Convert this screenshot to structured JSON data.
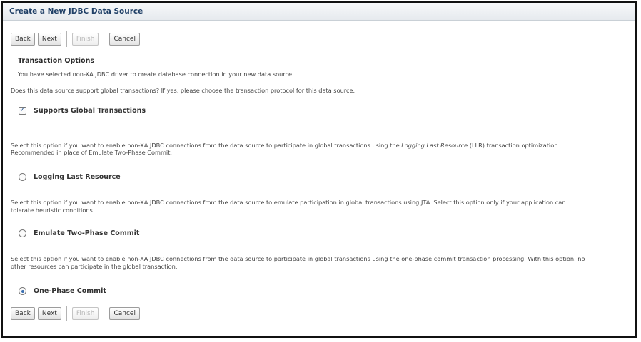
{
  "window": {
    "title": "Create a New JDBC Data Source"
  },
  "buttons": {
    "back": "Back",
    "next": "Next",
    "finish": "Finish",
    "cancel": "Cancel"
  },
  "section": {
    "title": "Transaction Options",
    "info": "You have selected non-XA JDBC driver to create database connection in your new data source.",
    "question": "Does this data source support global transactions? If yes, please choose the transaction protocol for this data source."
  },
  "global": {
    "label": "Supports Global Transactions",
    "checked": true
  },
  "options": [
    {
      "desc_line1_a": "Select this option if you want to enable non-XA JDBC connections from the data source to participate in global transactions using the ",
      "desc_line1_italic": "Logging Last Resource",
      "desc_line1_b": " (LLR) transaction optimization.",
      "desc_line2": "Recommended in place of Emulate Two-Phase Commit.",
      "label": "Logging Last Resource",
      "selected": false
    },
    {
      "desc_line1": "Select this option if you want to enable non-XA JDBC connections from the data source to emulate participation in global transactions using JTA. Select this option only if your application can",
      "desc_line2": "tolerate heuristic conditions.",
      "label": "Emulate Two-Phase Commit",
      "selected": false
    },
    {
      "desc_line1": "Select this option if you want to enable non-XA JDBC connections from the data source to participate in global transactions using the one-phase commit transaction processing. With this option, no",
      "desc_line2": "other resources can participate in the global transaction.",
      "label": "One-Phase Commit",
      "selected": true
    }
  ],
  "colors": {
    "title_text": "#1f3f66",
    "radio_dot": "#3a6fb0"
  }
}
